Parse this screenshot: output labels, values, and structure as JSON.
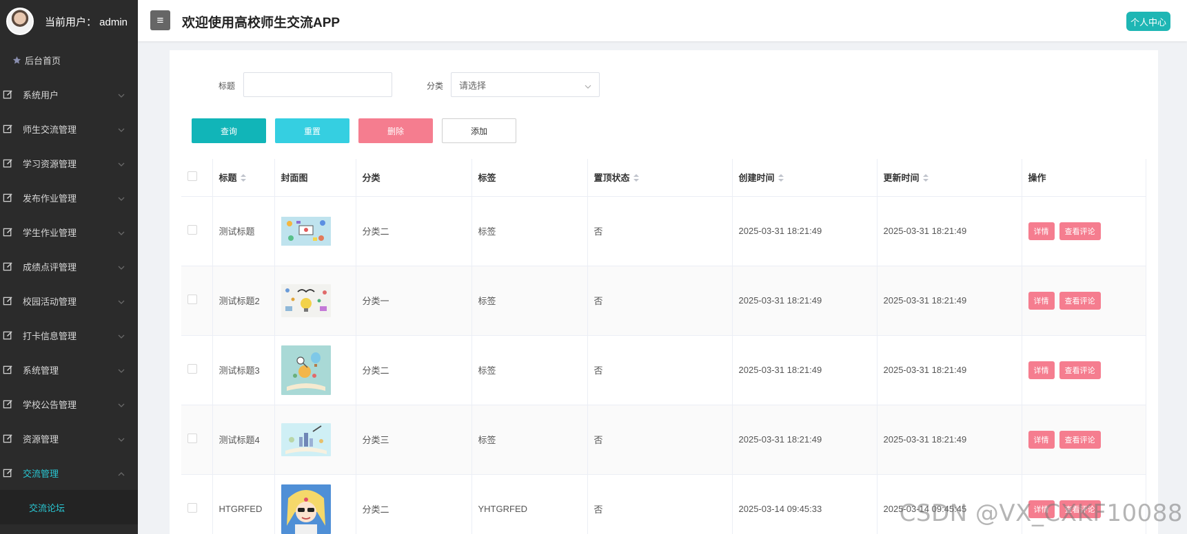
{
  "sidebar": {
    "user_label": "当前用户：  admin",
    "home": "后台首页",
    "items": [
      {
        "label": "系统用户",
        "icon": "edit-icon"
      },
      {
        "label": "师生交流管理",
        "icon": "edit-icon"
      },
      {
        "label": "学习资源管理",
        "icon": "edit-icon"
      },
      {
        "label": "发布作业管理",
        "icon": "edit-icon"
      },
      {
        "label": "学生作业管理",
        "icon": "edit-icon"
      },
      {
        "label": "成绩点评管理",
        "icon": "edit-icon"
      },
      {
        "label": "校园活动管理",
        "icon": "edit-icon"
      },
      {
        "label": "打卡信息管理",
        "icon": "edit-icon"
      },
      {
        "label": "系统管理",
        "icon": "edit-icon"
      },
      {
        "label": "学校公告管理",
        "icon": "edit-icon"
      },
      {
        "label": "资源管理",
        "icon": "edit-icon"
      },
      {
        "label": "交流管理",
        "icon": "edit-icon"
      }
    ],
    "active_sub": "交流论坛"
  },
  "header": {
    "menu_toggle": "≡",
    "title": "欢迎使用高校师生交流APP",
    "personal_center": "个人中心"
  },
  "search": {
    "title_label": "标题",
    "title_value": "",
    "category_label": "分类",
    "category_placeholder": "请选择"
  },
  "buttons": {
    "query": "查询",
    "reset": "重置",
    "delete": "删除",
    "add": "添加"
  },
  "table": {
    "headers": {
      "title": "标题",
      "cover": "封面图",
      "category": "分类",
      "tag": "标签",
      "pinned": "置顶状态",
      "created": "创建时间",
      "updated": "更新时间",
      "actions": "操作"
    },
    "detail_label": "详情",
    "comments_label": "查看评论",
    "rows": [
      {
        "title": "测试标题",
        "category": "分类二",
        "tag": "标签",
        "pinned": "否",
        "created": "2025-03-31 18:21:49",
        "updated": "2025-03-31 18:21:49"
      },
      {
        "title": "测试标题2",
        "category": "分类一",
        "tag": "标签",
        "pinned": "否",
        "created": "2025-03-31 18:21:49",
        "updated": "2025-03-31 18:21:49"
      },
      {
        "title": "测试标题3",
        "category": "分类二",
        "tag": "标签",
        "pinned": "否",
        "created": "2025-03-31 18:21:49",
        "updated": "2025-03-31 18:21:49"
      },
      {
        "title": "测试标题4",
        "category": "分类三",
        "tag": "标签",
        "pinned": "否",
        "created": "2025-03-31 18:21:49",
        "updated": "2025-03-31 18:21:49"
      },
      {
        "title": "HTGRFED",
        "category": "分类二",
        "tag": "YHTGRFED",
        "pinned": "否",
        "created": "2025-03-14 09:45:33",
        "updated": "2025-03-14 09:45:45"
      }
    ]
  },
  "watermark": "CSDN @VX_CXKF10088",
  "colors": {
    "sidebar_bg": "#2b2b2b",
    "accent_teal": "#11b5b8",
    "reset_cyan": "#35cfe1",
    "danger_pink": "#f57d8f",
    "active_menu": "#29c7d3"
  }
}
